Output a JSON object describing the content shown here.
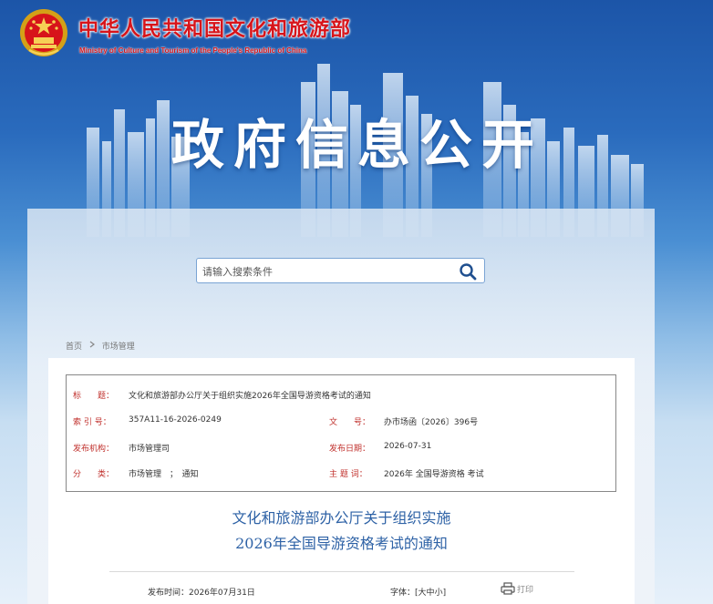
{
  "header": {
    "ministry_cn": "中华人民共和国文化和旅游部",
    "ministry_en": "Ministry of Culture and Tourism of the People's Republic of China",
    "banner_title": "政府信息公开",
    "brand_color": "#d7141a"
  },
  "search": {
    "placeholder": "请输入搜索条件",
    "icon": "search-icon"
  },
  "breadcrumb": {
    "home": "首页",
    "separator_icon": "chevron-right-icon",
    "current": "市场管理"
  },
  "meta": {
    "title_label": "标　　题：",
    "title_value": "文化和旅游部办公厅关于组织实施2026年全国导游资格考试的通知",
    "index_label": "索 引 号：",
    "index_value": "357A11-16-2026-0249",
    "docno_label": "文　　号：",
    "docno_value": "办市场函〔2026〕396号",
    "org_label": "发布机构：",
    "org_value": "市场管理司",
    "date_label": "发布日期：",
    "date_value": "2026-07-31",
    "category_label": "分　　类：",
    "category_value": "市场管理　；　通知",
    "topic_label": "主 题 词：",
    "topic_value": "2026年 全国导游资格 考试",
    "label_color": "#c0302c"
  },
  "article": {
    "title_line1": "文化和旅游部办公厅关于组织实施",
    "title_line2": "2026年全国导游资格考试的通知",
    "title_color": "#2e62a6",
    "publish_time": "发布时间：2026年07月31日",
    "font_size_label": "字体：",
    "font_size_open": "[",
    "font_size_large": "大",
    "font_size_medium": "中",
    "font_size_small": "小",
    "font_size_close": "]",
    "print_label": "打印",
    "print_icon": "printer-icon"
  }
}
